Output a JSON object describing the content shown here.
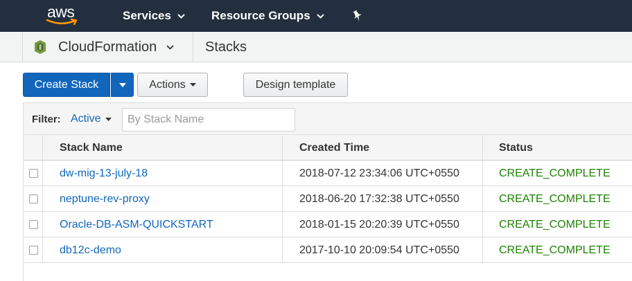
{
  "nav": {
    "logo_text": "aws",
    "services_label": "Services",
    "resource_groups_label": "Resource Groups",
    "colors": {
      "nav_bg": "#232f3e",
      "smile": "#ff9900"
    }
  },
  "service_bar": {
    "service_name": "CloudFormation",
    "page_name": "Stacks"
  },
  "toolbar": {
    "create_stack_label": "Create Stack",
    "actions_label": "Actions",
    "design_template_label": "Design template"
  },
  "filter": {
    "label": "Filter:",
    "selected": "Active",
    "search_placeholder": "By Stack Name"
  },
  "table": {
    "headers": {
      "name": "Stack Name",
      "created": "Created Time",
      "status": "Status"
    },
    "rows": [
      {
        "name": "dw-mig-13-july-18",
        "created": "2018-07-12 23:34:06 UTC+0550",
        "status": "CREATE_COMPLETE"
      },
      {
        "name": "neptune-rev-proxy",
        "created": "2018-06-20 17:32:38 UTC+0550",
        "status": "CREATE_COMPLETE"
      },
      {
        "name": "Oracle-DB-ASM-QUICKSTART",
        "created": "2018-01-15 20:20:39 UTC+0550",
        "status": "CREATE_COMPLETE"
      },
      {
        "name": "db12c-demo",
        "created": "2017-10-10 20:09:54 UTC+0550",
        "status": "CREATE_COMPLETE"
      }
    ]
  },
  "colors": {
    "link": "#1166bb",
    "status_ok": "#1d8102",
    "primary_button": "#1166bb"
  }
}
